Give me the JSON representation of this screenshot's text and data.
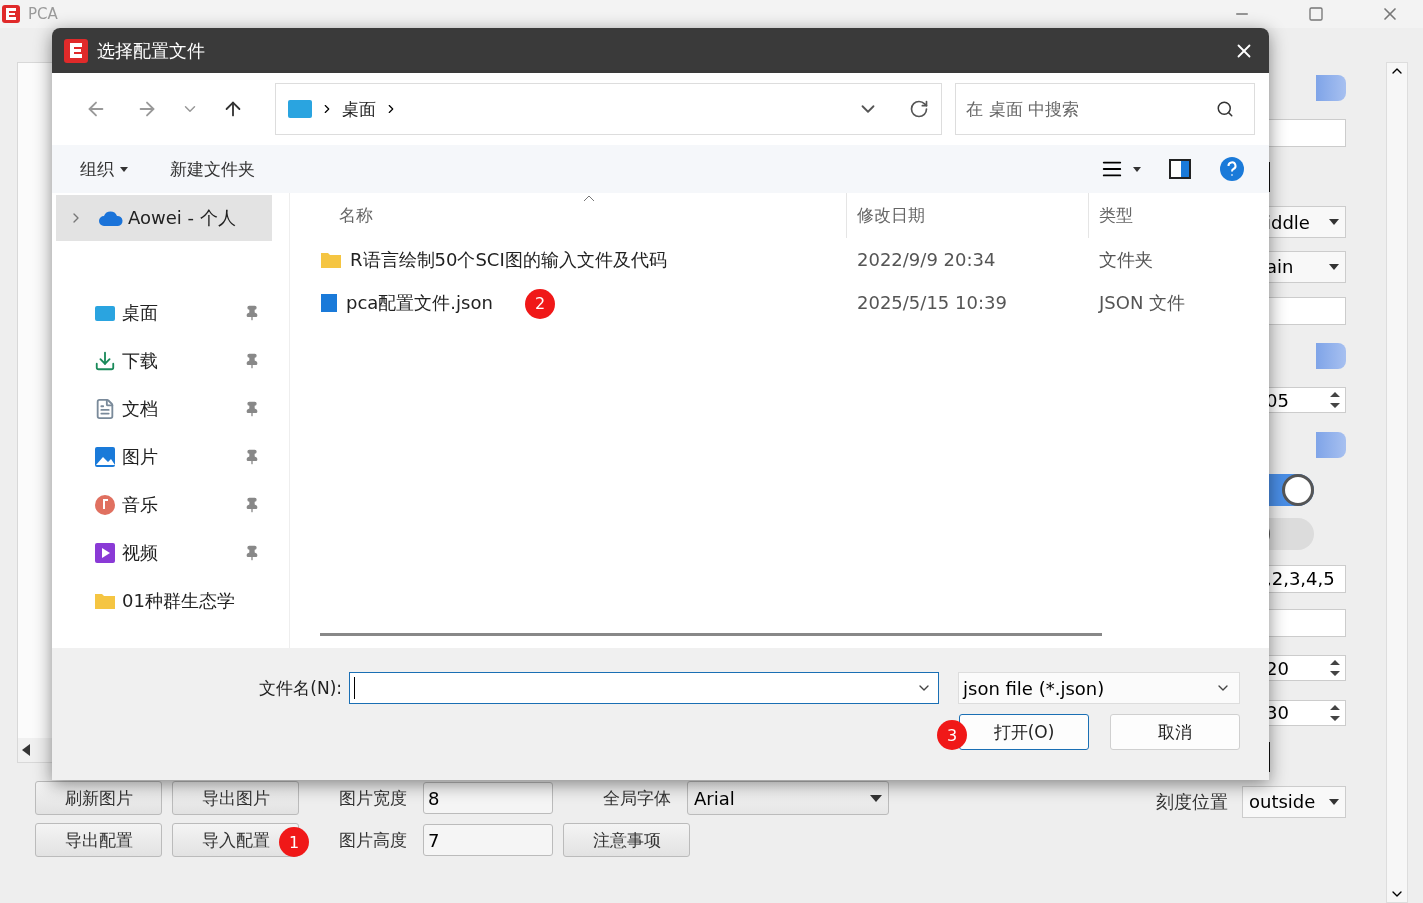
{
  "app": {
    "title": "PCA"
  },
  "side_panel": [
    {
      "kind": "tab"
    },
    {
      "kind": "input"
    },
    {
      "kind": "swatch"
    },
    {
      "kind": "select",
      "value": "iddle"
    },
    {
      "kind": "select",
      "value": "ain"
    },
    {
      "kind": "input"
    },
    {
      "kind": "tab"
    },
    {
      "kind": "spin",
      "value": "05"
    },
    {
      "kind": "tab"
    },
    {
      "kind": "toggle",
      "on": true
    },
    {
      "kind": "toggle",
      "on": false
    },
    {
      "kind": "input",
      "value": ",2,3,4,5"
    },
    {
      "kind": "input"
    },
    {
      "kind": "spin",
      "value": "20"
    },
    {
      "kind": "spin",
      "value": "30"
    },
    {
      "kind": "swatch"
    },
    {
      "kind": "select",
      "label": "刻度位置",
      "value": "outside"
    }
  ],
  "toolbar": {
    "row1": [
      {
        "kind": "button",
        "label": "刷新图片"
      },
      {
        "kind": "button",
        "label": "导出图片"
      },
      {
        "kind": "field",
        "label": "图片宽度",
        "value": "8"
      },
      {
        "kind": "select",
        "label": "全局字体",
        "value": "Arial"
      }
    ],
    "row2": [
      {
        "kind": "button",
        "label": "导出配置"
      },
      {
        "kind": "button",
        "label": "导入配置",
        "badge": "1"
      },
      {
        "kind": "field",
        "label": "图片高度",
        "value": "7"
      },
      {
        "kind": "button",
        "label": "注意事项"
      }
    ]
  },
  "dialog": {
    "title": "选择配置文件",
    "breadcrumb": [
      "桌面"
    ],
    "search": {
      "placeholder": "在 桌面 中搜索"
    },
    "commands": [
      {
        "label": "组织",
        "menu": true
      },
      {
        "label": "新建文件夹",
        "menu": false
      }
    ],
    "sidebar": [
      {
        "kind": "cloud",
        "label": "Aowei - 个人",
        "selected": true,
        "pinned": false,
        "expandable": true
      },
      {
        "kind": "desktop",
        "label": "桌面",
        "selected": false,
        "pinned": true,
        "expandable": false
      },
      {
        "kind": "downloads",
        "label": "下载",
        "selected": false,
        "pinned": true,
        "expandable": false
      },
      {
        "kind": "documents",
        "label": "文档",
        "selected": false,
        "pinned": true,
        "expandable": false
      },
      {
        "kind": "pictures",
        "label": "图片",
        "selected": false,
        "pinned": true,
        "expandable": false
      },
      {
        "kind": "music",
        "label": "音乐",
        "selected": false,
        "pinned": true,
        "expandable": false
      },
      {
        "kind": "videos",
        "label": "视频",
        "selected": false,
        "pinned": true,
        "expandable": false
      },
      {
        "kind": "folder",
        "label": "01种群生态学",
        "selected": false,
        "pinned": false,
        "expandable": false
      }
    ],
    "columns": [
      "名称",
      "修改日期",
      "类型"
    ],
    "files": [
      {
        "kind": "folder",
        "name": "R语言绘制50个SCI图的输入文件及代码",
        "modified": "2022/9/9 20:34",
        "type": "文件夹"
      },
      {
        "kind": "json",
        "name": "pca配置文件.json",
        "modified": "2025/5/15 10:39",
        "type": "JSON 文件",
        "badge": "2"
      }
    ],
    "filename_label": "文件名(N):",
    "filter": "json file (*.json)",
    "buttons": [
      {
        "label": "打开(O)",
        "primary": true,
        "badge": "3"
      },
      {
        "label": "取消",
        "primary": false
      }
    ]
  }
}
